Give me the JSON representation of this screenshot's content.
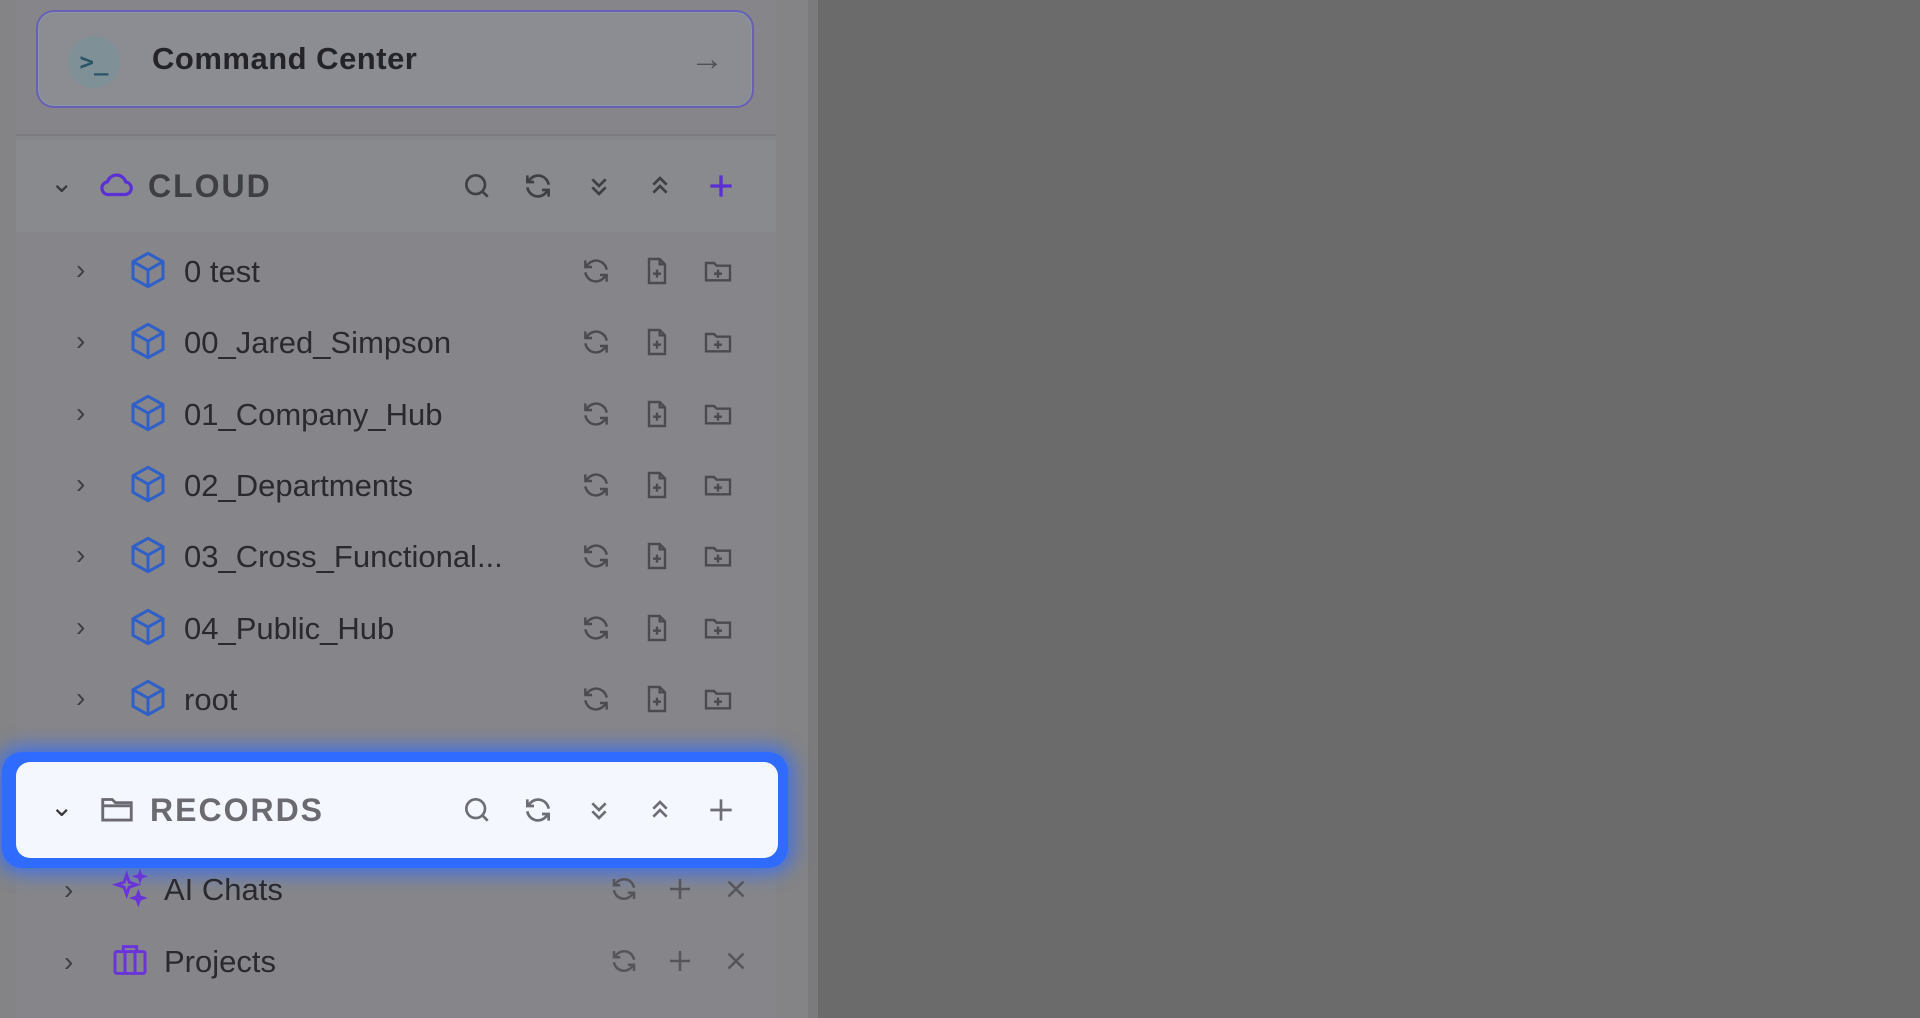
{
  "command_center": {
    "label": "Command Center",
    "icon": "terminal-icon",
    "arrow_icon": "arrow-right-icon"
  },
  "cloud": {
    "title": "CLOUD",
    "accent": "#5a2fd6",
    "tools": [
      "search-icon",
      "refresh-icon",
      "collapse-all-icon",
      "expand-all-icon",
      "add-icon"
    ],
    "items": [
      {
        "label": "0 test"
      },
      {
        "label": "00_Jared_Simpson"
      },
      {
        "label": "01_Company_Hub"
      },
      {
        "label": "02_Departments"
      },
      {
        "label": "03_Cross_Functional..."
      },
      {
        "label": "04_Public_Hub"
      },
      {
        "label": "root"
      }
    ]
  },
  "records": {
    "title": "RECORDS",
    "highlight": "#2f6bff",
    "tools": [
      "search-icon",
      "refresh-icon",
      "collapse-all-icon",
      "expand-all-icon",
      "add-icon"
    ],
    "items": [
      {
        "label": "AI Chats",
        "icon": "sparkles-icon"
      },
      {
        "label": "Projects",
        "icon": "briefcase-icon"
      }
    ]
  }
}
